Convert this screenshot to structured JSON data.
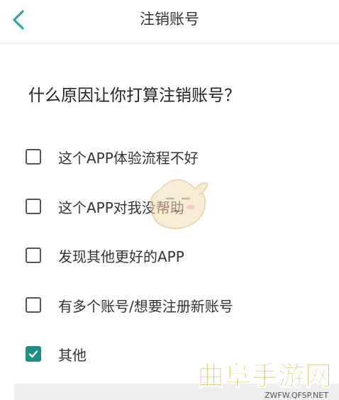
{
  "header": {
    "title": "注销账号"
  },
  "question": "什么原因让你打算注销账号？",
  "options": [
    {
      "label": "这个APP体验流程不好",
      "checked": false
    },
    {
      "label": "这个APP对我没帮助",
      "checked": false
    },
    {
      "label": "发现其他更好的APP",
      "checked": false
    },
    {
      "label": "有多个账号/想要注册新账号",
      "checked": false
    },
    {
      "label": "其他",
      "checked": true
    }
  ],
  "watermark": {
    "brand": "曲阜手游网",
    "url": "ZWFW.QFSP.NET"
  },
  "colors": {
    "accent": "#1f8f86",
    "back_icon": "#2fa9a0",
    "divider": "#e8e8e8",
    "watermark": "#c9a41a"
  },
  "icons": {
    "back": "chevron-left-icon",
    "check": "checkmark-icon",
    "mascot": "mascot-icon"
  }
}
